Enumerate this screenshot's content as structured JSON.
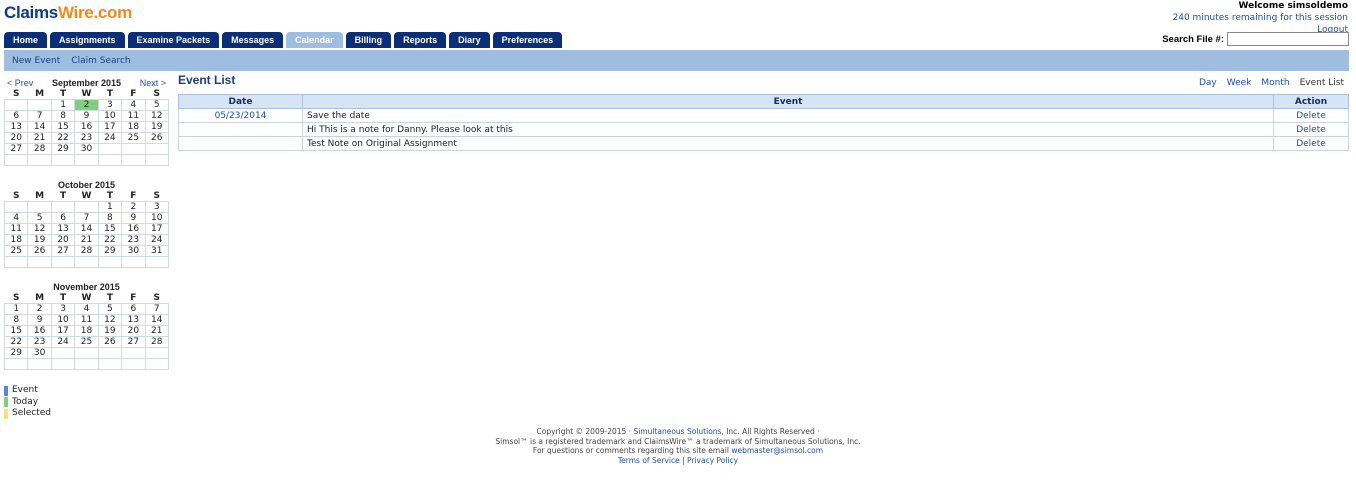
{
  "logo": {
    "part1": "Claims",
    "part2": "Wire.com"
  },
  "welcome": {
    "user": "Welcome simsoldemo",
    "session": "240 minutes remaining for this session",
    "logout": "Logout"
  },
  "tabs": [
    "Home",
    "Assignments",
    "Examine Packets",
    "Messages",
    "Calendar",
    "Billing",
    "Reports",
    "Diary",
    "Preferences"
  ],
  "active_tab": "Calendar",
  "search": {
    "label": "Search File #:",
    "value": "",
    "placeholder": ""
  },
  "subnav": {
    "new_event": "New Event",
    "claim_search": "Claim Search"
  },
  "calendar_nav": {
    "prev": "< Prev",
    "next": "Next >"
  },
  "day_headers": [
    "S",
    "M",
    "T",
    "W",
    "T",
    "F",
    "S"
  ],
  "months": [
    {
      "title": "September 2015",
      "today": "2",
      "weeks": [
        [
          "",
          "",
          "1",
          "2",
          "3",
          "4",
          "5"
        ],
        [
          "6",
          "7",
          "8",
          "9",
          "10",
          "11",
          "12"
        ],
        [
          "13",
          "14",
          "15",
          "16",
          "17",
          "18",
          "19"
        ],
        [
          "20",
          "21",
          "22",
          "23",
          "24",
          "25",
          "26"
        ],
        [
          "27",
          "28",
          "29",
          "30",
          "",
          "",
          ""
        ],
        [
          "",
          "",
          "",
          "",
          "",
          "",
          ""
        ]
      ]
    },
    {
      "title": "October 2015",
      "weeks": [
        [
          "",
          "",
          "",
          "",
          "1",
          "2",
          "3"
        ],
        [
          "4",
          "5",
          "6",
          "7",
          "8",
          "9",
          "10"
        ],
        [
          "11",
          "12",
          "13",
          "14",
          "15",
          "16",
          "17"
        ],
        [
          "18",
          "19",
          "20",
          "21",
          "22",
          "23",
          "24"
        ],
        [
          "25",
          "26",
          "27",
          "28",
          "29",
          "30",
          "31"
        ],
        [
          "",
          "",
          "",
          "",
          "",
          "",
          ""
        ]
      ]
    },
    {
      "title": "November 2015",
      "weeks": [
        [
          "1",
          "2",
          "3",
          "4",
          "5",
          "6",
          "7"
        ],
        [
          "8",
          "9",
          "10",
          "11",
          "12",
          "13",
          "14"
        ],
        [
          "15",
          "16",
          "17",
          "18",
          "19",
          "20",
          "21"
        ],
        [
          "22",
          "23",
          "24",
          "25",
          "26",
          "27",
          "28"
        ],
        [
          "29",
          "30",
          "",
          "",
          "",
          "",
          ""
        ],
        [
          "",
          "",
          "",
          "",
          "",
          "",
          ""
        ]
      ]
    }
  ],
  "legend": [
    {
      "label": "Event",
      "color": "#5b86d6"
    },
    {
      "label": "Today",
      "color": "#7fd07c"
    },
    {
      "label": "Selected",
      "color": "#f5e27a"
    }
  ],
  "event_list": {
    "title": "Event List",
    "views": [
      "Day",
      "Week",
      "Month",
      "Event List"
    ],
    "current_view": "Event List",
    "columns": [
      "Date",
      "Event",
      "Action"
    ],
    "rows": [
      {
        "date": "05/23/2014",
        "event": "Save the date",
        "action": "Delete"
      },
      {
        "date": "",
        "event": "Hi This is a note for Danny. Please look at this",
        "action": "Delete"
      },
      {
        "date": "",
        "event": "Test Note on Original Assignment",
        "action": "Delete"
      }
    ]
  },
  "footer": {
    "copyright": "Copyright © 2009-2015 · ",
    "company": "Simultaneous Solutions, Inc.",
    "rights": " All Rights Reserved ·",
    "trademark": "Simsol™ is a registered trademark and ClaimsWire™ a trademark of Simultaneous Solutions, Inc.",
    "contact": "For questions or comments regarding this site email ",
    "email": "webmaster@simsol.com",
    "terms": "Terms of Service",
    "sep": " | ",
    "privacy": "Privacy Policy"
  },
  "colors": {
    "nav_tab": "#0a2f78",
    "active_tab": "#9fbde0",
    "subbar": "#9ebde0",
    "link": "#1f4fa0",
    "today": "#7fd07c"
  }
}
